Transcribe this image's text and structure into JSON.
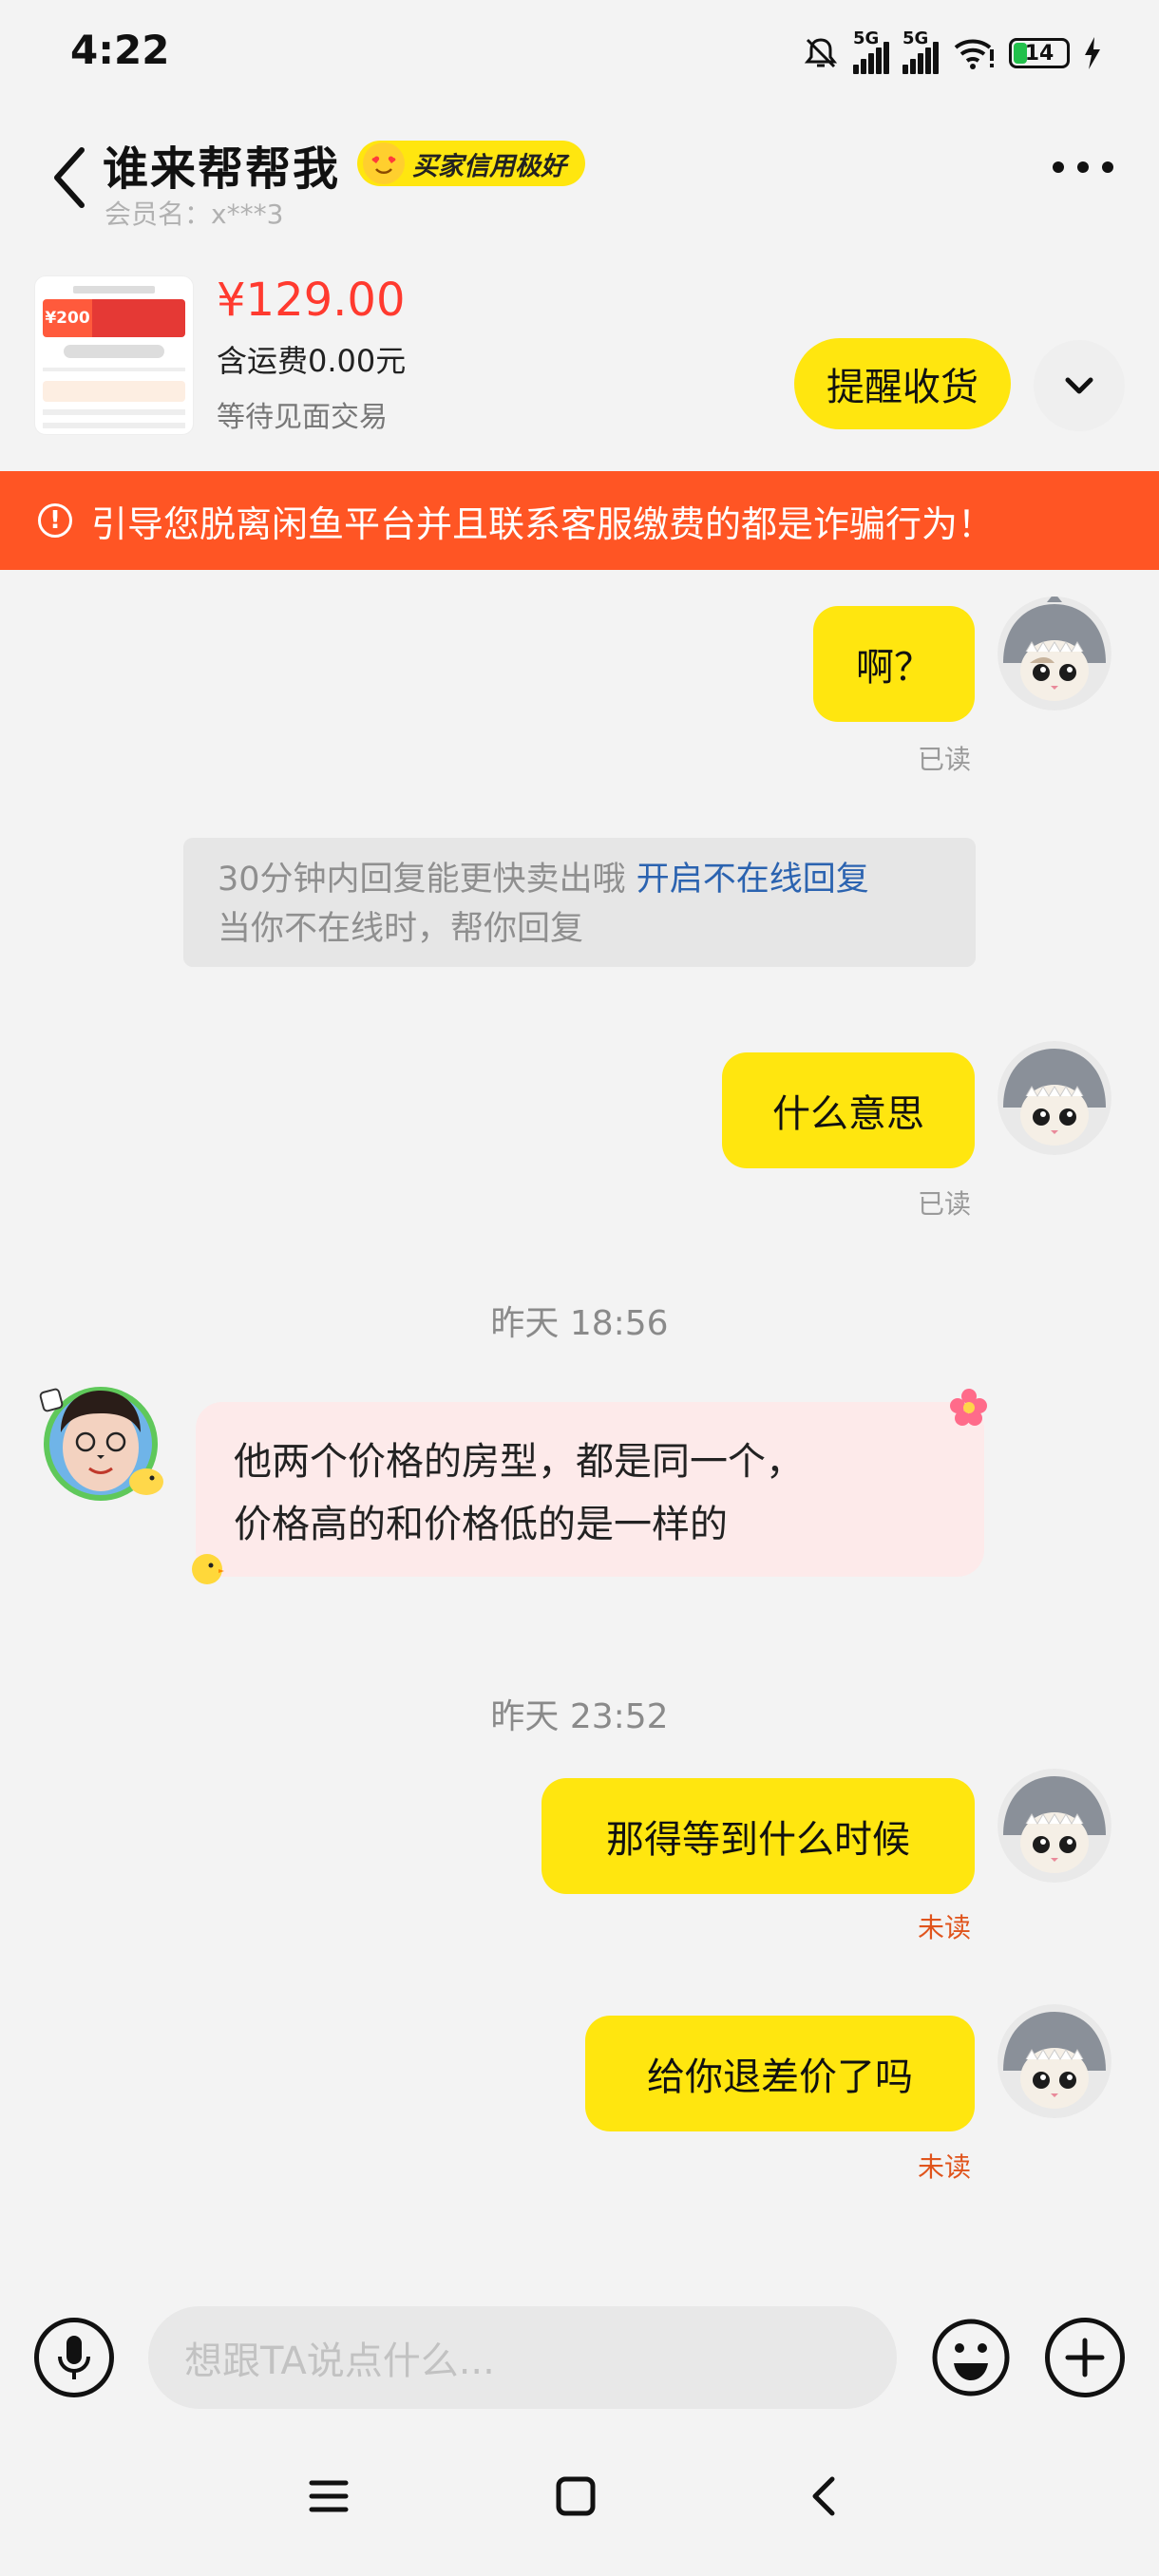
{
  "status_bar": {
    "time": "4:22",
    "network1": "5G",
    "network2": "5G",
    "battery": "14"
  },
  "header": {
    "title": "谁来帮帮我",
    "badge": "买家信用极好",
    "member": "会员名：x***3"
  },
  "product": {
    "price": "¥129.00",
    "shipping": "含运费0.00元",
    "status": "等待见面交易",
    "thumb_price": "¥200",
    "remind_label": "提醒收货"
  },
  "warning": "引导您脱离闲鱼平台并且联系客服缴费的都是诈骗行为！",
  "messages": {
    "m1": {
      "text": "啊？",
      "receipt": "已读"
    },
    "system": {
      "text": "30分钟内回复能更快卖出哦",
      "link": "开启不在线回复",
      "line2": "当你不在线时，帮你回复"
    },
    "m2": {
      "text": "什么意思",
      "receipt": "已读"
    },
    "time1": "昨天 18:56",
    "incoming": {
      "line1": "他两个价格的房型，都是同一个，",
      "line2": "价格高的和价格低的是一样的"
    },
    "time2": "昨天 23:52",
    "m3": {
      "text": "那得等到什么时候",
      "receipt": "未读"
    },
    "m4": {
      "text": "给你退差价了吗",
      "receipt": "未读"
    }
  },
  "input": {
    "placeholder": "想跟TA说点什么..."
  },
  "colors": {
    "accent": "#ffe60f",
    "warning": "#ff5524",
    "price": "#ff3a2f",
    "unread": "#e0541c"
  }
}
